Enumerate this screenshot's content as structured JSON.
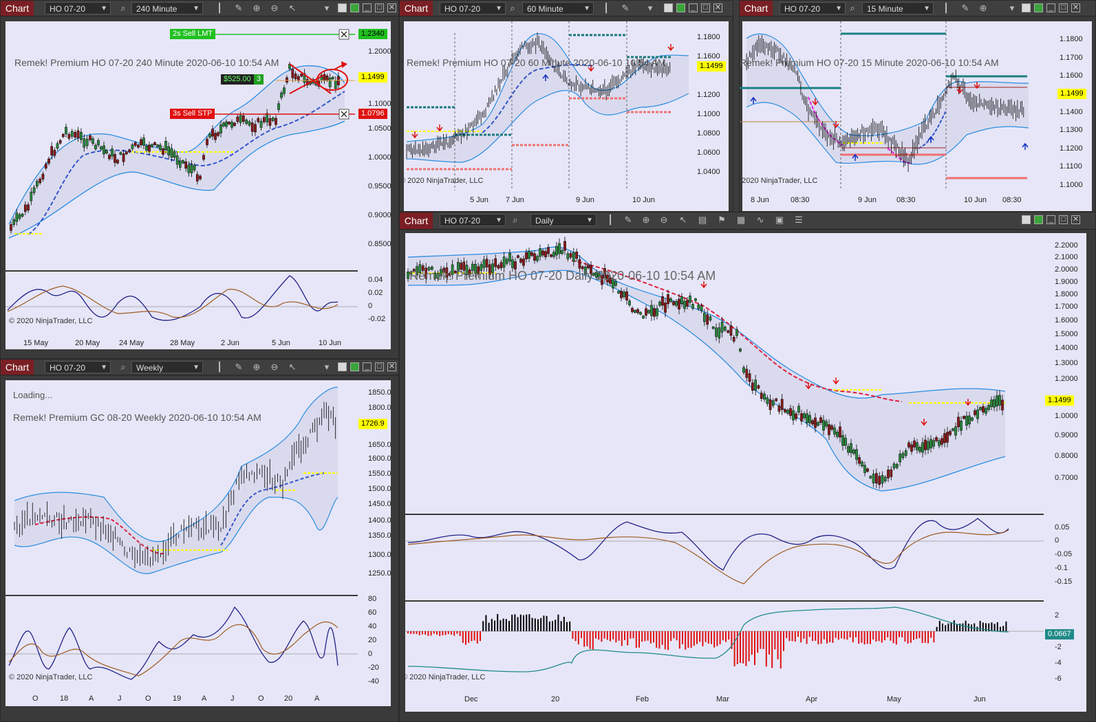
{
  "common": {
    "chart_label": "Chart",
    "instrument": "HO 07-20"
  },
  "w1": {
    "interval": "240 Minute",
    "title": "Remek!  Premium  HO 07-20  240 Minute  2020-06-10 10:54 AM",
    "prices": [
      "1.2000",
      "1.1500",
      "1.1000",
      "1.0500",
      "1.0000",
      "0.9500",
      "0.9000",
      "0.8500"
    ],
    "osc": [
      "0.04",
      "0.02",
      "0",
      "-0.02"
    ],
    "xlabels": [
      "15 May",
      "20 May",
      "24 May",
      "28 May",
      "2 Jun",
      "5 Jun",
      "10 Jun"
    ],
    "last": "1.1499",
    "sell_lmt_label": "2s  Sell LMT",
    "sell_lmt_price": "1.2340",
    "sell_stp_label": "3s  Sell STP",
    "sell_stp_price": "1.0796",
    "pnl": "$525.00",
    "pnl_qty": "3",
    "copyright": "© 2020 NinjaTrader, LLC"
  },
  "w2": {
    "interval": "60 Minute",
    "title": "Remek!  Premium  HO 07-20  60 Minute  2020-06-10 10:54 AM",
    "prices": [
      "1.1800",
      "1.1600",
      "1.1400",
      "1.1200",
      "1.1000",
      "1.0800",
      "1.0600",
      "1.0400"
    ],
    "xlabels": [
      "5 Jun",
      "7 Jun",
      "9 Jun",
      "10 Jun"
    ],
    "last": "1.1499",
    "copyright": "© 2020 NinjaTrader, LLC"
  },
  "w3": {
    "interval": "15 Minute",
    "title": "Remek!  Premium  HO 07-20  15 Minute  2020-06-10 10:54 AM",
    "prices": [
      "1.1800",
      "1.1700",
      "1.1600",
      "1.1500",
      "1.1400",
      "1.1300",
      "1.1200",
      "1.1100",
      "1.1000"
    ],
    "xlabels": [
      "8 Jun",
      "08:30",
      "9 Jun",
      "08:30",
      "10 Jun",
      "08:30"
    ],
    "last": "1.1499",
    "copyright": "© 2020 NinjaTrader, LLC"
  },
  "w4": {
    "instrument": "HO 07-20",
    "interval": "Weekly",
    "loading": "Loading...",
    "title": "Remek!  Premium  GC 08-20  Weekly  2020-06-10 10:54 AM",
    "prices": [
      "1850.0",
      "1800.0",
      "1750.0",
      "1700.0",
      "1650.0",
      "1600.0",
      "1550.0",
      "1500.0",
      "1450.0",
      "1400.0",
      "1350.0",
      "1300.0",
      "1250.0"
    ],
    "osc": [
      "80",
      "60",
      "40",
      "20",
      "0",
      "-20",
      "-40"
    ],
    "xlabels": [
      "O",
      "18",
      "A",
      "J",
      "O",
      "19",
      "A",
      "J",
      "O",
      "20",
      "A"
    ],
    "last": "1726.9",
    "copyright": "© 2020 NinjaTrader, LLC"
  },
  "w5": {
    "interval": "Daily",
    "title": "Remek!  Premium  HO 07-20  Daily  2020-06-10 10:54 AM",
    "prices": [
      "2.2000",
      "2.1000",
      "2.0000",
      "1.9000",
      "1.8000",
      "1.7000",
      "1.6000",
      "1.5000",
      "1.4000",
      "1.3000",
      "1.2000",
      "1.1000",
      "1.0000",
      "0.9000",
      "0.8000",
      "0.7000"
    ],
    "osc1": [
      "0.05",
      "0",
      "-0.05",
      "-0.1",
      "-0.15"
    ],
    "osc2": [
      "2",
      "-2",
      "-4",
      "-6"
    ],
    "xlabels": [
      "Dec",
      "20",
      "Feb",
      "Mar",
      "Apr",
      "May",
      "Jun"
    ],
    "last": "1.1499",
    "hist_last": "0.0667",
    "copyright": "© 2020 NinjaTrader, LLC"
  }
}
